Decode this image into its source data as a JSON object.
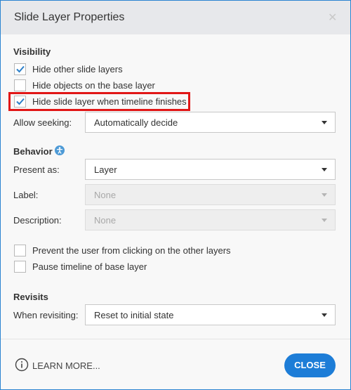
{
  "window": {
    "title": "Slide Layer Properties",
    "close_glyph": "✕"
  },
  "visibility": {
    "heading": "Visibility",
    "options": [
      {
        "label": "Hide other slide layers",
        "checked": true
      },
      {
        "label": "Hide objects on the base layer",
        "checked": false
      },
      {
        "label": "Hide slide layer when timeline finishes",
        "checked": true
      }
    ],
    "allow_seeking": {
      "label": "Allow seeking:",
      "value": "Automatically decide"
    }
  },
  "behavior": {
    "heading": "Behavior",
    "info_icon": "accessibility-icon",
    "present_as": {
      "label": "Present as:",
      "value": "Layer"
    },
    "label_field": {
      "label": "Label:",
      "value": "None",
      "disabled": true
    },
    "description_field": {
      "label": "Description:",
      "value": "None",
      "disabled": true
    },
    "options": [
      {
        "label": "Prevent the user from clicking on the other layers",
        "checked": false
      },
      {
        "label": "Pause timeline of base layer",
        "checked": false
      }
    ]
  },
  "revisits": {
    "heading": "Revisits",
    "when_revisiting": {
      "label": "When revisiting:",
      "value": "Reset to initial state"
    }
  },
  "footer": {
    "learn_more": "LEARN MORE...",
    "close": "CLOSE"
  },
  "colors": {
    "accent": "#1d7dd7",
    "highlight": "#e11616",
    "checkmark": "#2b7fc9"
  }
}
